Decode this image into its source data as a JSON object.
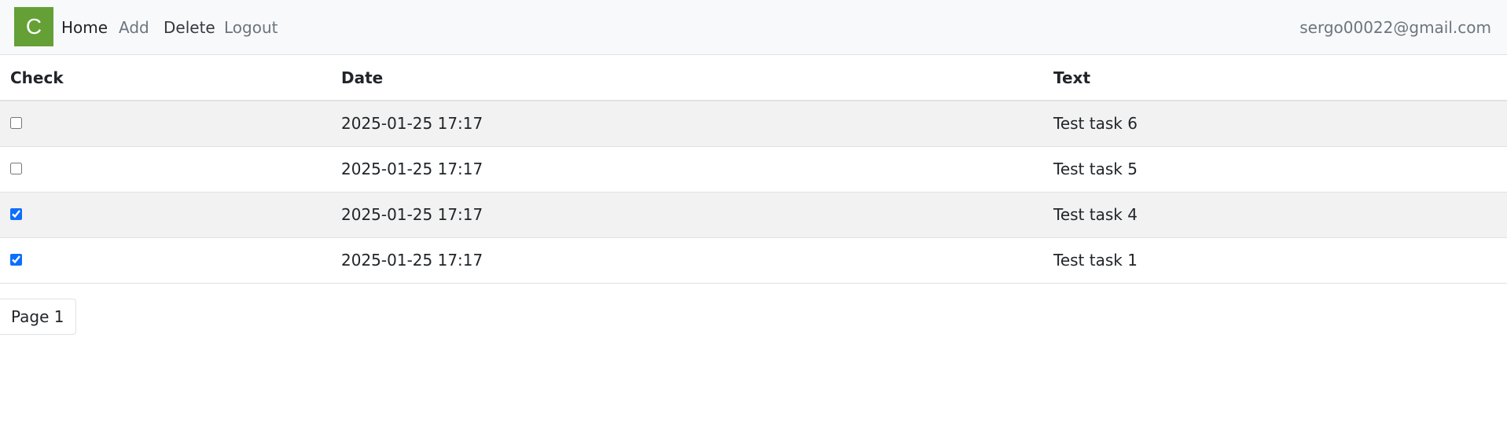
{
  "navbar": {
    "logo_letter": "C",
    "links": [
      {
        "label": "Home"
      },
      {
        "label": "Add"
      },
      {
        "label": "Delete"
      },
      {
        "label": "Logout"
      }
    ],
    "user_email": "sergo00022@gmail.com"
  },
  "table": {
    "headers": {
      "check": "Check",
      "date": "Date",
      "text": "Text"
    },
    "rows": [
      {
        "checked": false,
        "date": "2025-01-25 17:17",
        "text": "Test task 6"
      },
      {
        "checked": false,
        "date": "2025-01-25 17:17",
        "text": "Test task 5"
      },
      {
        "checked": true,
        "date": "2025-01-25 17:17",
        "text": "Test task 4"
      },
      {
        "checked": true,
        "date": "2025-01-25 17:17",
        "text": "Test task 1"
      }
    ]
  },
  "pagination": {
    "label": "Page 1"
  },
  "colors": {
    "logo_bg": "#64a036",
    "navbar_bg": "#f8f9fa",
    "stripe_bg": "#f2f2f2",
    "checkbox_accent": "#0d6efd"
  }
}
